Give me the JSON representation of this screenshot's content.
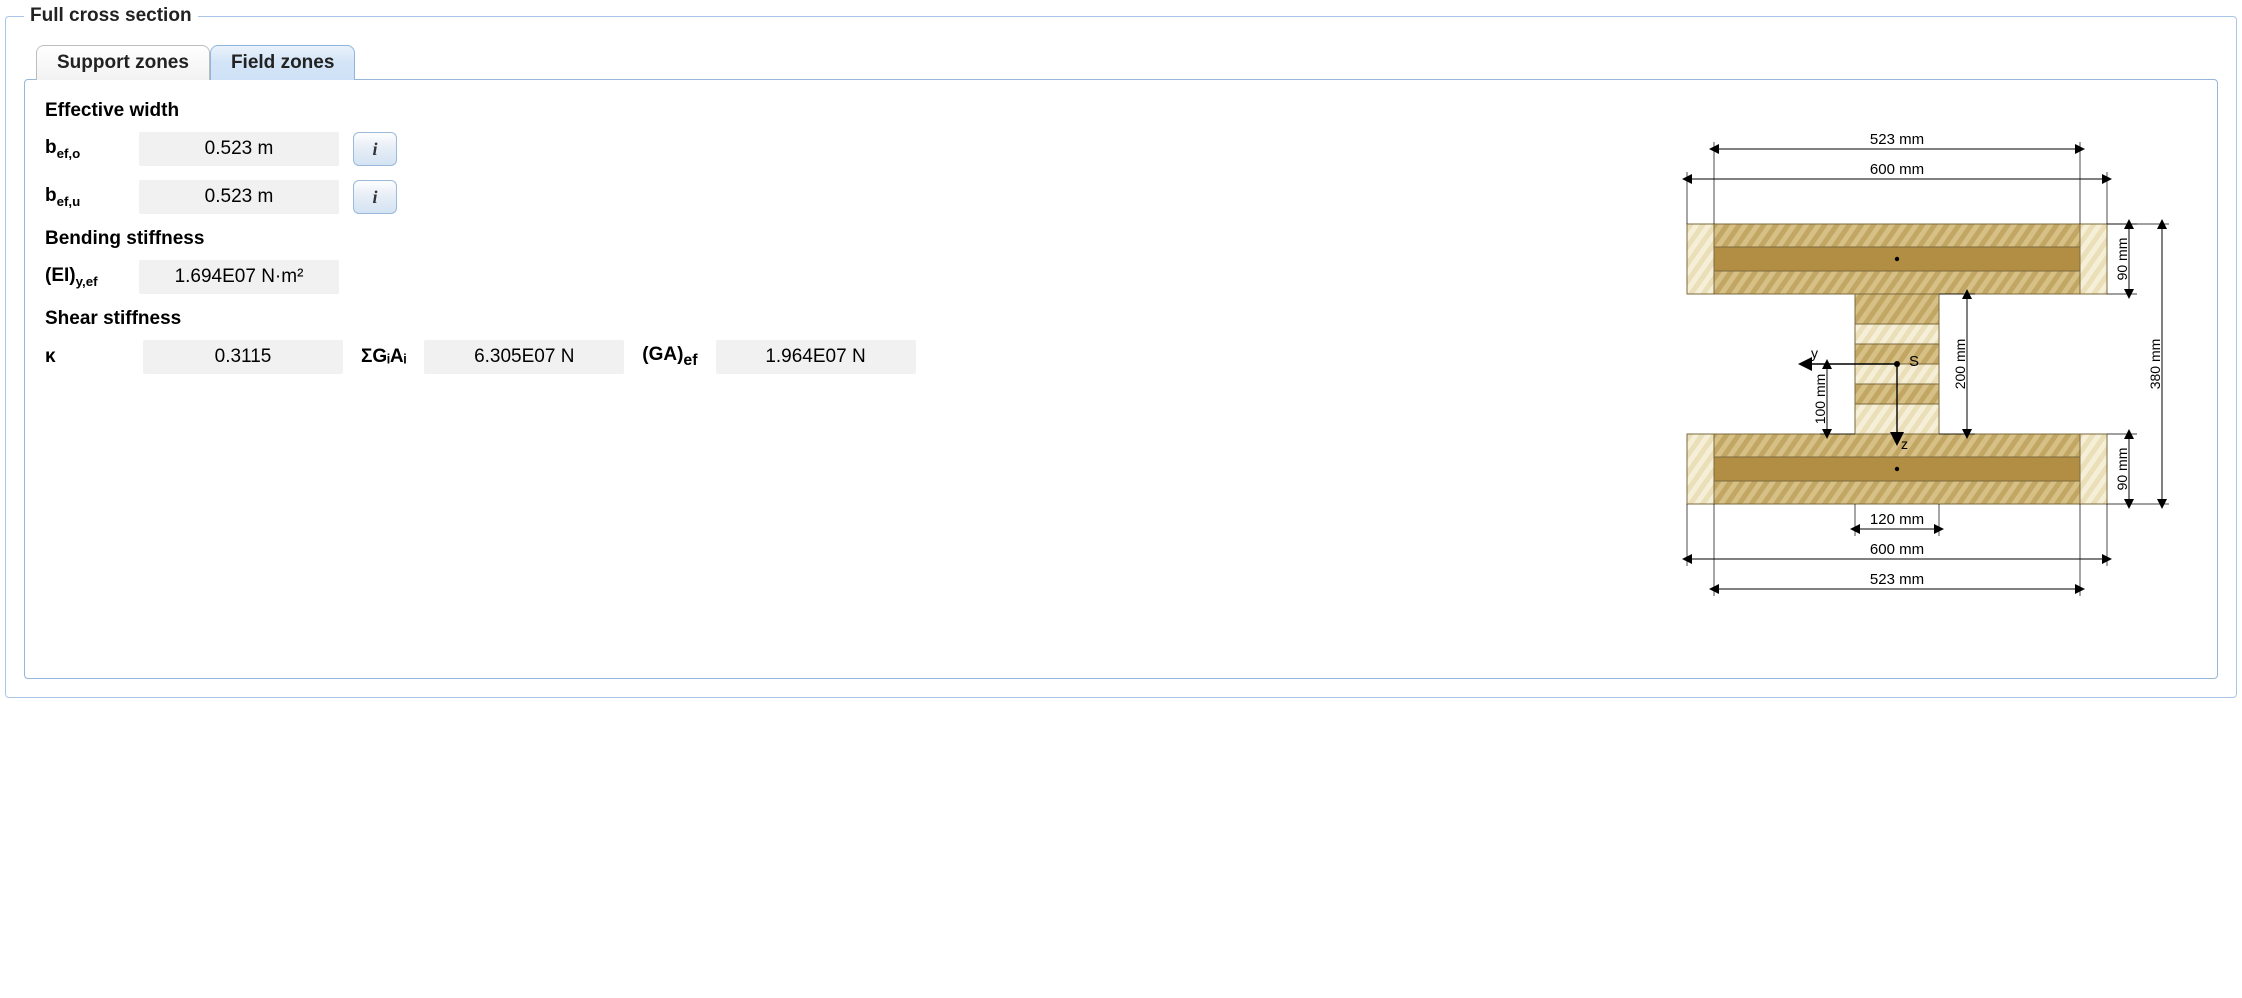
{
  "legend": "Full cross section",
  "tabs": [
    {
      "label": "Support zones",
      "active": false
    },
    {
      "label": "Field zones",
      "active": true
    }
  ],
  "sections": {
    "effective_width": {
      "title": "Effective width",
      "rows": [
        {
          "sym": "b",
          "sub": "ef,o",
          "value": "0.523 m",
          "info": "i"
        },
        {
          "sym": "b",
          "sub": "ef,u",
          "value": "0.523 m",
          "info": "i"
        }
      ]
    },
    "bending_stiffness": {
      "title": "Bending stiffness",
      "rows": [
        {
          "sym": "(EI)",
          "sub": "y,ef",
          "value": "1.694E07 N·m²"
        }
      ]
    },
    "shear_stiffness": {
      "title": "Shear stiffness",
      "items": [
        {
          "label": "κ",
          "value": "0.3115"
        },
        {
          "label_html": "ΣGᵢAᵢ",
          "value": "6.305E07 N"
        },
        {
          "label_html_pre": "(GA)",
          "label_sub": "ef",
          "value": "1.964E07 N"
        }
      ]
    }
  },
  "diagram": {
    "dim_top1": "523 mm",
    "dim_top2": "600 mm",
    "dim_right_top": "90 mm",
    "dim_right_total": "380 mm",
    "dim_mid_right": "200 mm",
    "dim_mid_left": "100 mm",
    "dim_right_bottom": "90 mm",
    "dim_web": "120 mm",
    "dim_bottom1": "600 mm",
    "dim_bottom2": "523 mm",
    "axis_y": "y",
    "axis_z": "z",
    "centroid": "S"
  }
}
